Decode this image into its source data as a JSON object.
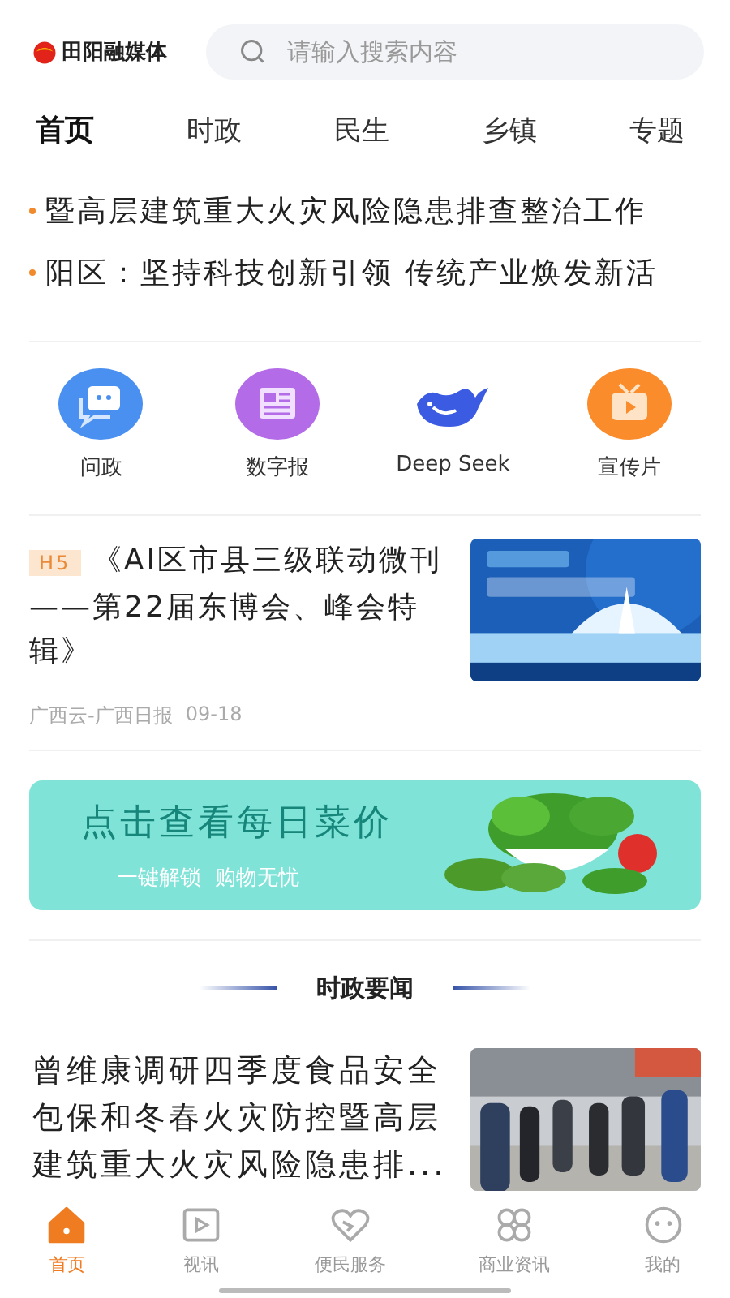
{
  "header": {
    "logo_text": "田阳融媒体",
    "search": {
      "placeholder": "请输入搜索内容"
    }
  },
  "tabs": [
    {
      "label": "首页",
      "selected": true
    },
    {
      "label": "时政",
      "selected": false
    },
    {
      "label": "民生",
      "selected": false
    },
    {
      "label": "乡镇",
      "selected": false
    },
    {
      "label": "专题",
      "selected": false
    }
  ],
  "ticker": [
    "暨高层建筑重大火灾风险隐患排查整治工作",
    "阳区：坚持科技创新引领 传统产业焕发新活"
  ],
  "shortcuts": [
    {
      "label": "问政",
      "kind": "chat"
    },
    {
      "label": "数字报",
      "kind": "newspaper"
    },
    {
      "label": "Deep Seek",
      "kind": "whale"
    },
    {
      "label": "宣传片",
      "kind": "tv"
    }
  ],
  "feature": {
    "tag": "H5",
    "title": "《AI区市县三级联动微刊——第22届东博会、峰会特辑》",
    "source": "广西云-广西日报",
    "date": "09-18"
  },
  "banner": {
    "title": "点击查看每日菜价",
    "subtitle": "一键解锁  购物无忧"
  },
  "section": {
    "title": "时政要闻"
  },
  "news": [
    {
      "title": "曾维康调研四季度食品安全包保和冬春火灾防控暨高层建筑重大火灾风险隐患排..."
    }
  ],
  "bottom_nav": [
    {
      "label": "首页",
      "kind": "home",
      "selected": true
    },
    {
      "label": "视讯",
      "kind": "video",
      "selected": false
    },
    {
      "label": "便民服务",
      "kind": "heart",
      "selected": false
    },
    {
      "label": "商业资讯",
      "kind": "grid",
      "selected": false
    },
    {
      "label": "我的",
      "kind": "face",
      "selected": false
    }
  ]
}
